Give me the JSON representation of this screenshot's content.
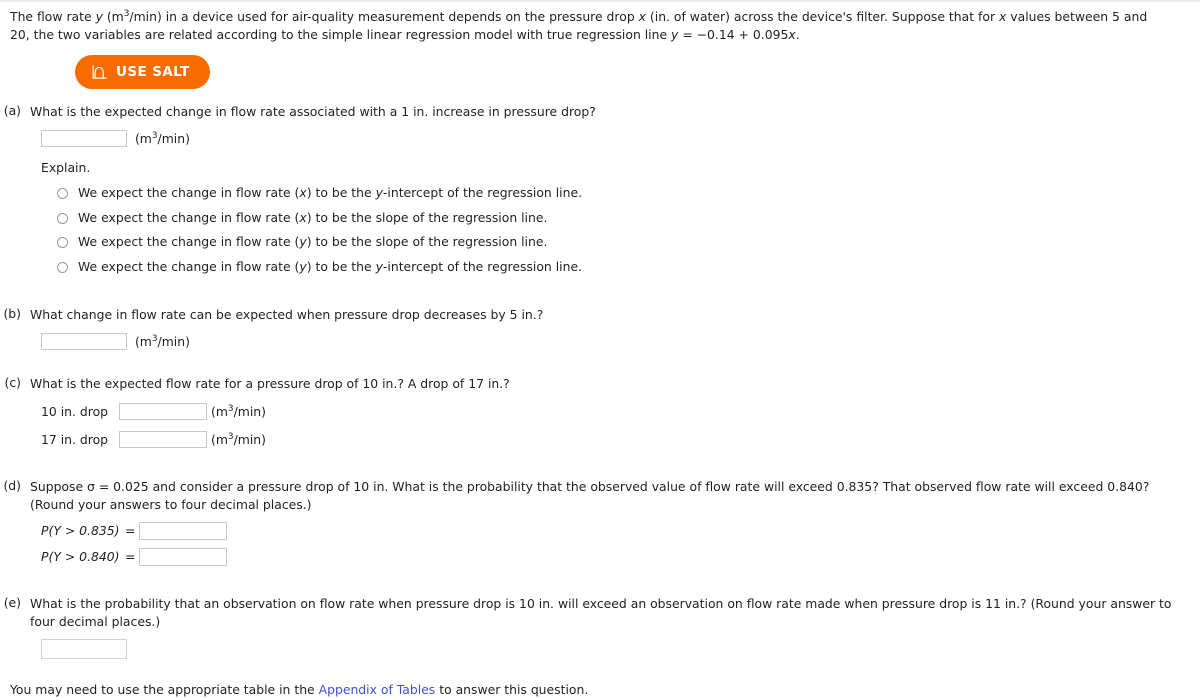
{
  "problem": {
    "intro_part1": "The flow rate ",
    "intro_var_y": "y",
    "intro_part2": " (m",
    "intro_sup3": "3",
    "intro_part3": "/min) in a device used for air-quality measurement depends on the pressure drop ",
    "intro_var_x": "x",
    "intro_part4": " (in. of water) across the device's filter. Suppose that for ",
    "intro_var_x2": "x",
    "intro_part5": " values between 5 and 20, the two variables are related according to the simple linear regression model with true regression line ",
    "intro_var_y2": "y",
    "intro_part6": " = −0.14 + 0.095",
    "intro_var_x3": "x",
    "intro_part7": "."
  },
  "salt": {
    "label": "USE SALT",
    "icon": "distribution-curve-icon",
    "color": "#f76b00"
  },
  "units": {
    "m3min_open": "(m",
    "m3min_sup": "3",
    "m3min_close": "/min)"
  },
  "parts": {
    "a": {
      "label": "(a)",
      "question": "What is the expected change in flow rate associated with a 1 in. increase in pressure drop?",
      "input_value": "",
      "explain_label": "Explain.",
      "options": [
        {
          "pre": "We expect the change in flow rate (",
          "var": "x",
          "mid": ") to be the ",
          "var2": "y",
          "post": "-intercept of the regression line.",
          "selected": false
        },
        {
          "pre": "We expect the change in flow rate (",
          "var": "x",
          "mid": ") to be the slope of the regression line.",
          "var2": "",
          "post": "",
          "selected": false
        },
        {
          "pre": "We expect the change in flow rate (",
          "var": "y",
          "mid": ") to be the slope of the regression line.",
          "var2": "",
          "post": "",
          "selected": false
        },
        {
          "pre": "We expect the change in flow rate (",
          "var": "y",
          "mid": ") to be the ",
          "var2": "y",
          "post": "-intercept of the regression line.",
          "selected": false
        }
      ]
    },
    "b": {
      "label": "(b)",
      "question": "What change in flow rate can be expected when pressure drop decreases by 5 in.?",
      "input_value": ""
    },
    "c": {
      "label": "(c)",
      "question": "What is the expected flow rate for a pressure drop of 10 in.? A drop of 17 in.?",
      "rows": [
        {
          "label": "10 in. drop",
          "input_value": ""
        },
        {
          "label": "17 in. drop",
          "input_value": ""
        }
      ]
    },
    "d": {
      "label": "(d)",
      "question_pre": "Suppose σ = 0.025 and consider a pressure drop of 10 in. What is the probability that the observed value of flow rate will exceed 0.835? That observed flow rate will exceed 0.840? (Round your answers to four decimal places.)",
      "rows": [
        {
          "label_open": "P",
          "label_body": "(Y > 0.835)",
          "eq": "=",
          "input_value": ""
        },
        {
          "label_open": "P",
          "label_body": "(Y > 0.840)",
          "eq": "=",
          "input_value": ""
        }
      ]
    },
    "e": {
      "label": "(e)",
      "question": "What is the probability that an observation on flow rate when pressure drop is 10 in. will exceed an observation on flow rate made when pressure drop is 11 in.? (Round your answer to four decimal places.)",
      "input_value": ""
    }
  },
  "footer": {
    "pre": "You may need to use the appropriate table in the ",
    "link": "Appendix of Tables",
    "post": " to answer this question.",
    "link_color": "#3f51cf"
  }
}
